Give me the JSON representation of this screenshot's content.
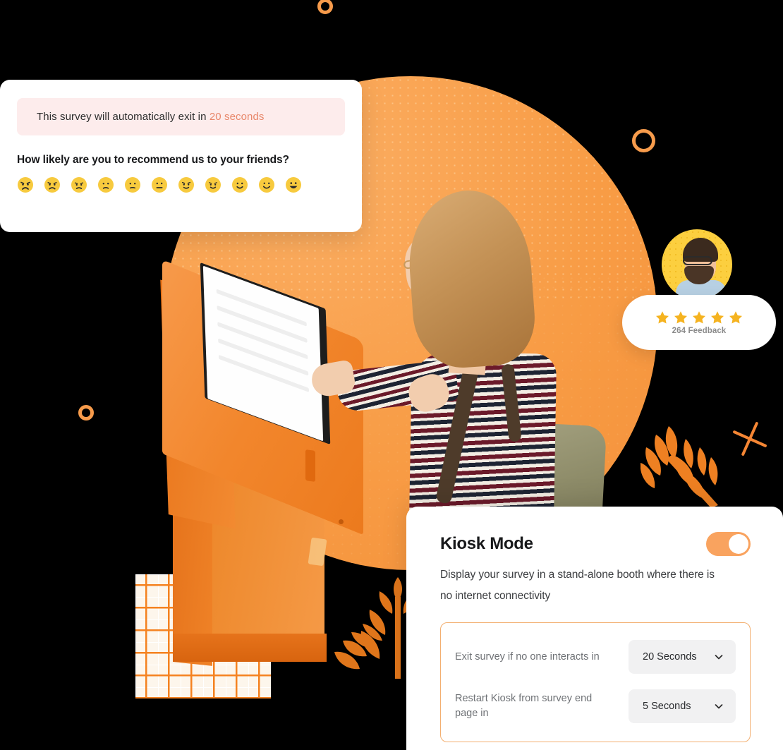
{
  "survey_card": {
    "alert": {
      "prefix": "This survey will automatically exit in ",
      "highlight": "20 seconds",
      "bg_color": "#FDECEC",
      "highlight_color": "#E8876A"
    },
    "question": "How likely are you to recommend us to your friends?",
    "emoji_scale": [
      {
        "name": "emoji-angry-1",
        "mood": "angry"
      },
      {
        "name": "emoji-angry-2",
        "mood": "angry"
      },
      {
        "name": "emoji-frown-3",
        "mood": "frown"
      },
      {
        "name": "emoji-slight-frown-4",
        "mood": "slight-frown"
      },
      {
        "name": "emoji-slight-frown-5",
        "mood": "slight-frown"
      },
      {
        "name": "emoji-neutral-6",
        "mood": "neutral"
      },
      {
        "name": "emoji-slight-smile-7",
        "mood": "slight-smile"
      },
      {
        "name": "emoji-slight-smile-8",
        "mood": "slight-smile"
      },
      {
        "name": "emoji-smile-9",
        "mood": "smile"
      },
      {
        "name": "emoji-smile-10",
        "mood": "smile"
      },
      {
        "name": "emoji-grin-11",
        "mood": "grin"
      }
    ]
  },
  "feedback_badge": {
    "stars": 5,
    "star_color": "#F5B320",
    "count_label": "264 Feedback"
  },
  "kiosk_panel": {
    "title": "Kiosk Mode",
    "description": "Display your survey in a stand-alone booth where there is no internet connectivity",
    "toggle": {
      "state": "on",
      "on_color": "#F9A35F"
    },
    "settings": [
      {
        "label": "Exit survey if no one interacts in",
        "value": "20 Seconds",
        "icon": "chevron-down-icon"
      },
      {
        "label": "Restart Kiosk from survey end page in",
        "value": "5 Seconds",
        "icon": "chevron-down-icon"
      }
    ]
  },
  "theme": {
    "accent_orange": "#F58220",
    "hero_circle": "#F9A04E",
    "avatar_bg": "#FCCF3F",
    "panel_border": "#F3AF70",
    "background": "#000000"
  }
}
